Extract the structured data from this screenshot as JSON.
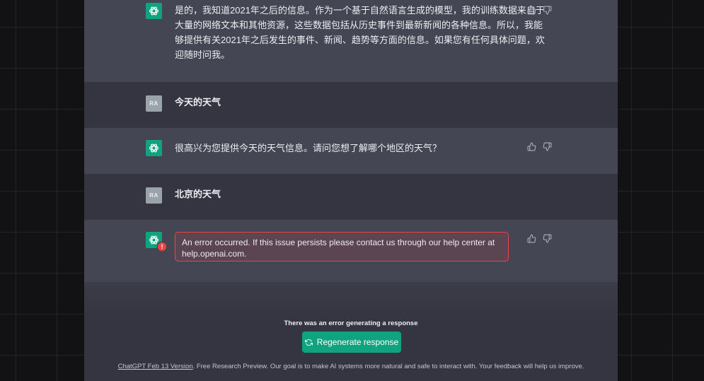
{
  "colors": {
    "brand": "#10a37f",
    "chat_bg": "#343541",
    "assistant_row_bg": "#444654",
    "error": "#ef4146",
    "outer_bg": "#121214"
  },
  "messages": [
    {
      "role": "assistant",
      "icon": "openai-logo-icon",
      "lines": [
        "是的，我知道2021年之后的信息。作为一个基于自然语言生成的模型，我的训练数据来自于",
        "大量的网络文本和其他资源，这些数据包括从历史事件到最新新闻的各种信息。所以，我能",
        "够提供有关2021年之后发生的事件、新闻、趋势等方面的信息。如果您有任何具体问题，欢",
        "迎随时问我。"
      ]
    },
    {
      "role": "user",
      "avatar": "RA",
      "text": "今天的天气"
    },
    {
      "role": "assistant",
      "icon": "openai-logo-icon",
      "text": "很高兴为您提供今天的天气信息。请问您想了解哪个地区的天气？"
    },
    {
      "role": "user",
      "avatar": "RA",
      "text": "北京的天气"
    },
    {
      "role": "assistant",
      "icon": "openai-logo-icon",
      "error": true,
      "error_badge": "!",
      "error_lines": [
        "An error occurred. If this issue persists please contact us through our help center at",
        "help.openai.com."
      ]
    }
  ],
  "feedback_icons": [
    "thumbs-up-icon",
    "thumbs-down-icon"
  ],
  "bottom": {
    "error_note": "There was an error generating a response",
    "regenerate_label": "Regenerate response",
    "regenerate_icon": "refresh-icon",
    "footer_link": "ChatGPT Feb 13 Version",
    "footer_text": ". Free Research Preview. Our goal is to make AI systems more natural and safe to interact with. Your feedback will help us improve."
  }
}
